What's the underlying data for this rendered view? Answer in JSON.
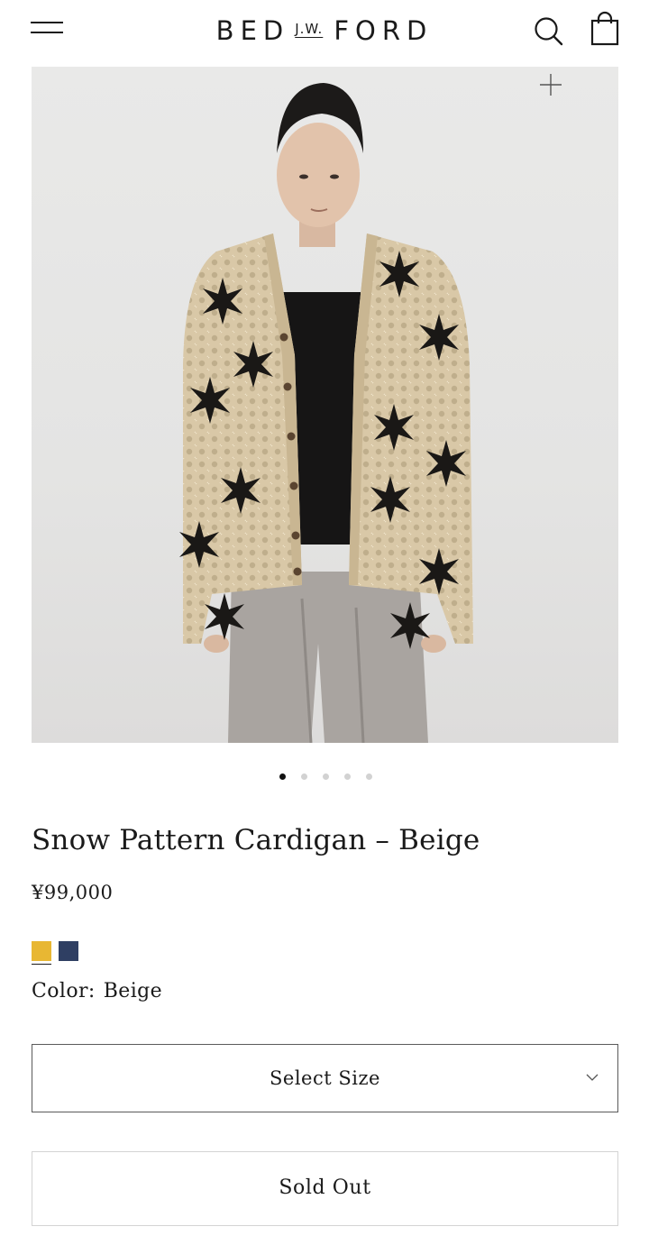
{
  "header": {
    "logo": {
      "left": "BED",
      "middle": "J.W.",
      "right": "FORD"
    },
    "icons": [
      "menu-icon",
      "search-icon",
      "cart-icon"
    ]
  },
  "gallery": {
    "image_alt": "Snow Pattern Cardigan – Beige",
    "image_count": 5,
    "active_index": 0,
    "zoom_icon": "plus-icon"
  },
  "product": {
    "title": "Snow Pattern Cardigan – Beige",
    "price": "¥99,000",
    "color_label": "Color:",
    "color_value": "Beige",
    "swatches": [
      {
        "name": "Beige",
        "color": "#e8b733",
        "selected": true
      },
      {
        "name": "Navy",
        "color": "#2f3f63",
        "selected": false
      }
    ],
    "size_select_label": "Select Size",
    "sold_out_label": "Sold Out"
  }
}
